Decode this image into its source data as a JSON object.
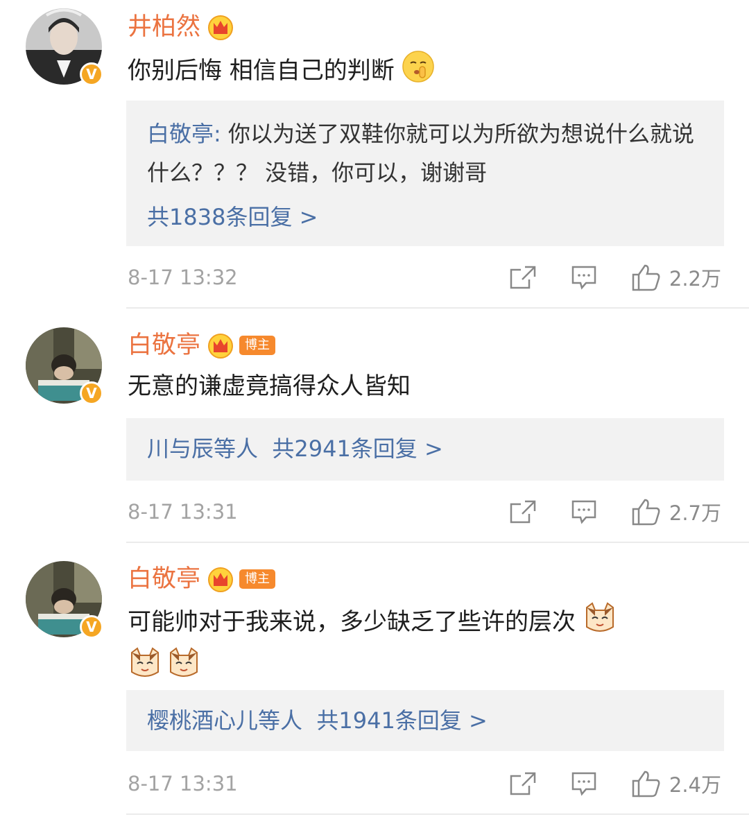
{
  "comments": [
    {
      "username": "井柏然",
      "tag": "",
      "text": "你别后悔 相信自己的判断",
      "reply_preview": {
        "user": "白敬亭",
        "sep": ": ",
        "text": "你以为送了双鞋你就可以为所欲为想说什么就说什么？？？ 没错，你可以，谢谢哥"
      },
      "reply_count": "共1838条回复 >",
      "time": "8-17 13:32",
      "likes": "2.2万"
    },
    {
      "username": "白敬亭",
      "tag": "博主",
      "text": "无意的谦虚竟搞得众人皆知",
      "reply_users": "川与辰等人",
      "reply_count": "共2941条回复 >",
      "time": "8-17 13:31",
      "likes": "2.7万"
    },
    {
      "username": "白敬亭",
      "tag": "博主",
      "text": "可能帅对于我来说，多少缺乏了些许的层次",
      "reply_users": "樱桃酒心儿等人",
      "reply_count": "共1941条回复 >",
      "time": "8-17 13:31",
      "likes": "2.4万"
    }
  ],
  "icons": {
    "verified": "verified-v-badge",
    "crown": "crown-icon",
    "share": "share-icon",
    "reply": "comment-icon",
    "like": "thumbs-up-icon"
  },
  "verified_letter": "V",
  "colors": {
    "username": "#eb7340",
    "reply_user": "#4a6fa5",
    "reply_bg": "#f2f2f2",
    "meta": "#a3a3a3",
    "tag_bg": "#f6892d"
  }
}
